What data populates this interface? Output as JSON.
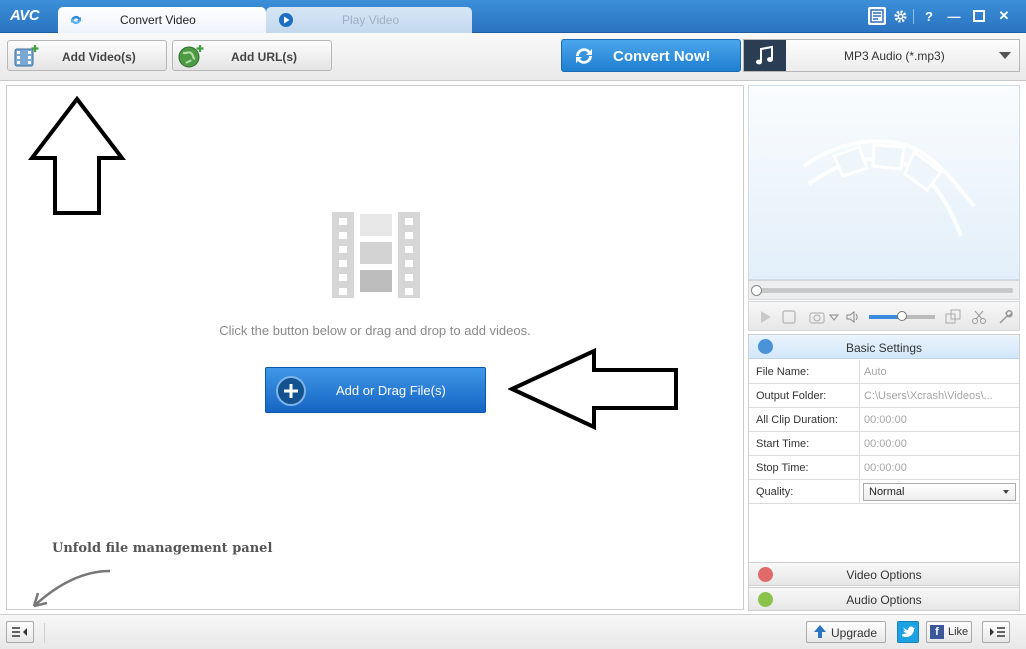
{
  "app": {
    "logo": "AVC",
    "tabs": [
      {
        "label": "Convert Video",
        "active": true
      },
      {
        "label": "Play Video",
        "active": false
      }
    ],
    "window_buttons": {
      "help": "?",
      "minimize": "—",
      "close": "✕"
    }
  },
  "toolbar": {
    "add_video_label": "Add Video(s)",
    "add_url_label": "Add URL(s)",
    "convert_label": "Convert Now!",
    "format_label": "MP3 Audio (*.mp3)"
  },
  "main": {
    "hint": "Click the button below or drag and drop to add videos.",
    "add_drag_label": "Add or Drag File(s)",
    "unfold_note": "Unfold file management panel"
  },
  "settings": {
    "header": "Basic Settings",
    "rows": [
      {
        "key": "File Name:",
        "value": "Auto"
      },
      {
        "key": "Output Folder:",
        "value": "C:\\Users\\Xcrash\\Videos\\..."
      },
      {
        "key": "All Clip Duration:",
        "value": "00:00:00"
      },
      {
        "key": "Start Time:",
        "value": "00:00:00"
      },
      {
        "key": "Stop Time:",
        "value": "00:00:00"
      },
      {
        "key": "Quality:",
        "value": "Normal"
      }
    ],
    "video_options": "Video Options",
    "audio_options": "Audio Options"
  },
  "player": {
    "volume": 0.5,
    "seek": 0.0
  },
  "statusbar": {
    "upgrade_label": "Upgrade",
    "like_label": "Like",
    "fb_letter": "f"
  },
  "colors": {
    "title_bar": "#2a74c2",
    "convert_button": "#1f7fd0",
    "add_drag_button": "#1565c4"
  },
  "icons": [
    "convert-tab-icon",
    "play-tab-icon",
    "menu-icon",
    "gear-icon",
    "add-video-icon",
    "add-url-icon",
    "refresh-icon",
    "music-note-icon",
    "film-strip-icon",
    "plus-icon",
    "settings-icon",
    "video-options-icon",
    "audio-options-icon",
    "upgrade-icon",
    "twitter-icon",
    "facebook-icon"
  ]
}
